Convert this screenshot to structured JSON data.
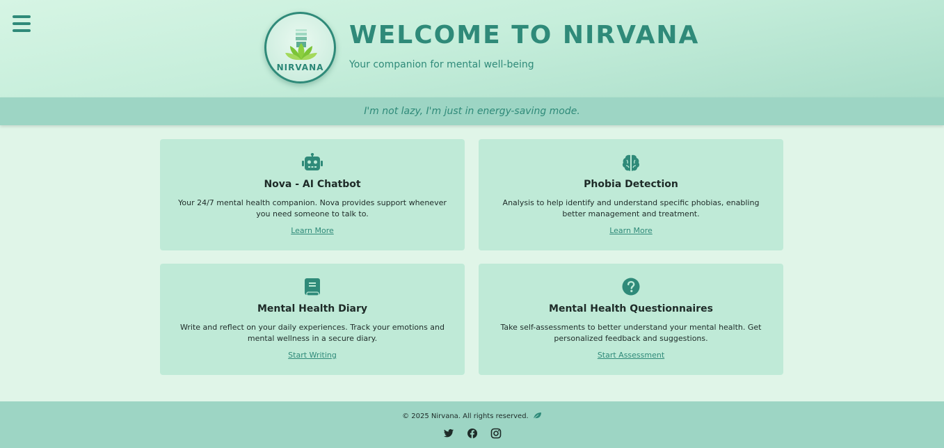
{
  "header": {
    "logo_text": "NIRVANA",
    "title": "WELCOME TO NIRVANA",
    "subtitle": "Your companion for mental well-being",
    "quote": "I'm not lazy, I'm just in energy-saving mode."
  },
  "icons": {
    "menu": "hamburger-menu-icon",
    "chatbot": "robot-icon",
    "phobia": "brain-icon",
    "diary": "book-icon",
    "questionnaire": "question-circle-icon",
    "footer_leaf": "leaf-icon",
    "social": [
      "twitter-icon",
      "facebook-icon",
      "instagram-icon"
    ]
  },
  "cards": [
    {
      "title": "Nova - AI Chatbot",
      "description": "Your 24/7 mental health companion. Nova provides support whenever you need someone to talk to.",
      "link": "Learn More"
    },
    {
      "title": "Phobia Detection",
      "description": "Analysis to help identify and understand specific phobias, enabling better management and treatment.",
      "link": "Learn More"
    },
    {
      "title": "Mental Health Diary",
      "description": "Write and reflect on your daily experiences. Track your emotions and mental wellness in a secure diary.",
      "link": "Start Writing"
    },
    {
      "title": "Mental Health Questionnaires",
      "description": "Take self-assessments to better understand your mental health. Get personalized feedback and suggestions.",
      "link": "Start Assessment"
    }
  ],
  "footer": {
    "copyright": "© 2025 Nirvana. All rights reserved."
  },
  "colors": {
    "accent": "#2f8a79",
    "background": "#e0f5e8",
    "card": "#bfead7",
    "bar": "#9dd5c4"
  }
}
